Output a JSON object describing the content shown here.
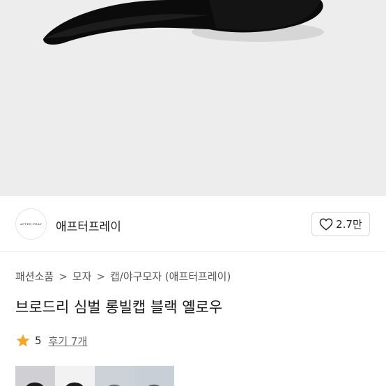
{
  "product_image": {
    "description_icon": "cap-image",
    "background": "#ededed",
    "cap_color": "#0c0c0c"
  },
  "brand": {
    "logo_text": "AFTER PRAY",
    "name": "애프터프레이",
    "like_count": "2.7만"
  },
  "breadcrumb": {
    "items": [
      "패션소품",
      "모자",
      "캡/야구모자 (애프터프레이)"
    ],
    "separator": ">"
  },
  "product": {
    "title": "브로드리 심벌 롱빌캡 블랙 옐로우"
  },
  "rating": {
    "score": "5",
    "review_label": "후기 7개",
    "star_color": "#f5a623"
  },
  "thumbnails": [
    {
      "name": "thumb-1",
      "bg": "#cfcfd4"
    },
    {
      "name": "thumb-2",
      "bg": "#f2f2f2"
    },
    {
      "name": "thumb-3",
      "bg": "#cdd1d8"
    },
    {
      "name": "thumb-4",
      "bg": "#c9cfd6"
    }
  ]
}
